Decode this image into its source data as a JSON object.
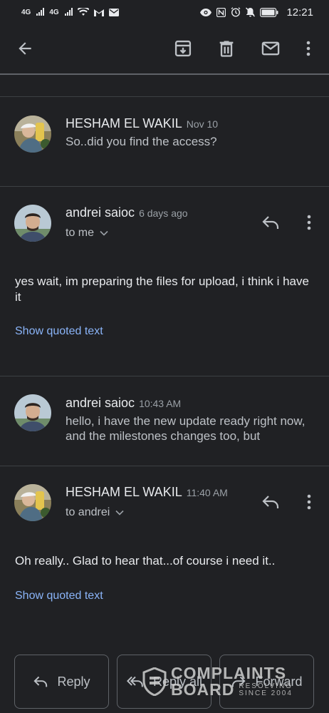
{
  "status_bar": {
    "network_1": "4G",
    "network_2": "4G",
    "time": "12:21"
  },
  "toolbar": {
    "icons": [
      "back-arrow-icon",
      "archive-icon",
      "delete-icon",
      "mark-unread-icon",
      "more-vert-icon"
    ]
  },
  "messages": [
    {
      "sender": "HESHAM EL WAKIL",
      "date": "Nov 10",
      "snippet": "So..did you find the access?"
    },
    {
      "sender": "andrei saioc",
      "date": "6 days ago",
      "to": "to me",
      "body": "yes wait, im preparing the files for upload, i think i have it",
      "quoted": "Show quoted text"
    },
    {
      "sender": "andrei saioc",
      "date": "10:43 AM",
      "snippet": "hello, i have the new update ready right now, and the milestones changes too, but"
    },
    {
      "sender": "HESHAM EL WAKIL",
      "date": "11:40 AM",
      "to": "to andrei",
      "body": "Oh really.. Glad to hear that...of course i need it..",
      "quoted": "Show quoted text"
    }
  ],
  "actions": {
    "reply": "Reply",
    "reply_all": "Reply all",
    "forward": "Forward"
  },
  "watermark": {
    "line1": "COMPLAINTS",
    "line2": "BOARD",
    "tagline_1": "RESOLVING",
    "tagline_2": "SINCE 2004"
  },
  "colors": {
    "background": "#202124",
    "link": "#8ab4f8",
    "divider": "#3c4043"
  }
}
